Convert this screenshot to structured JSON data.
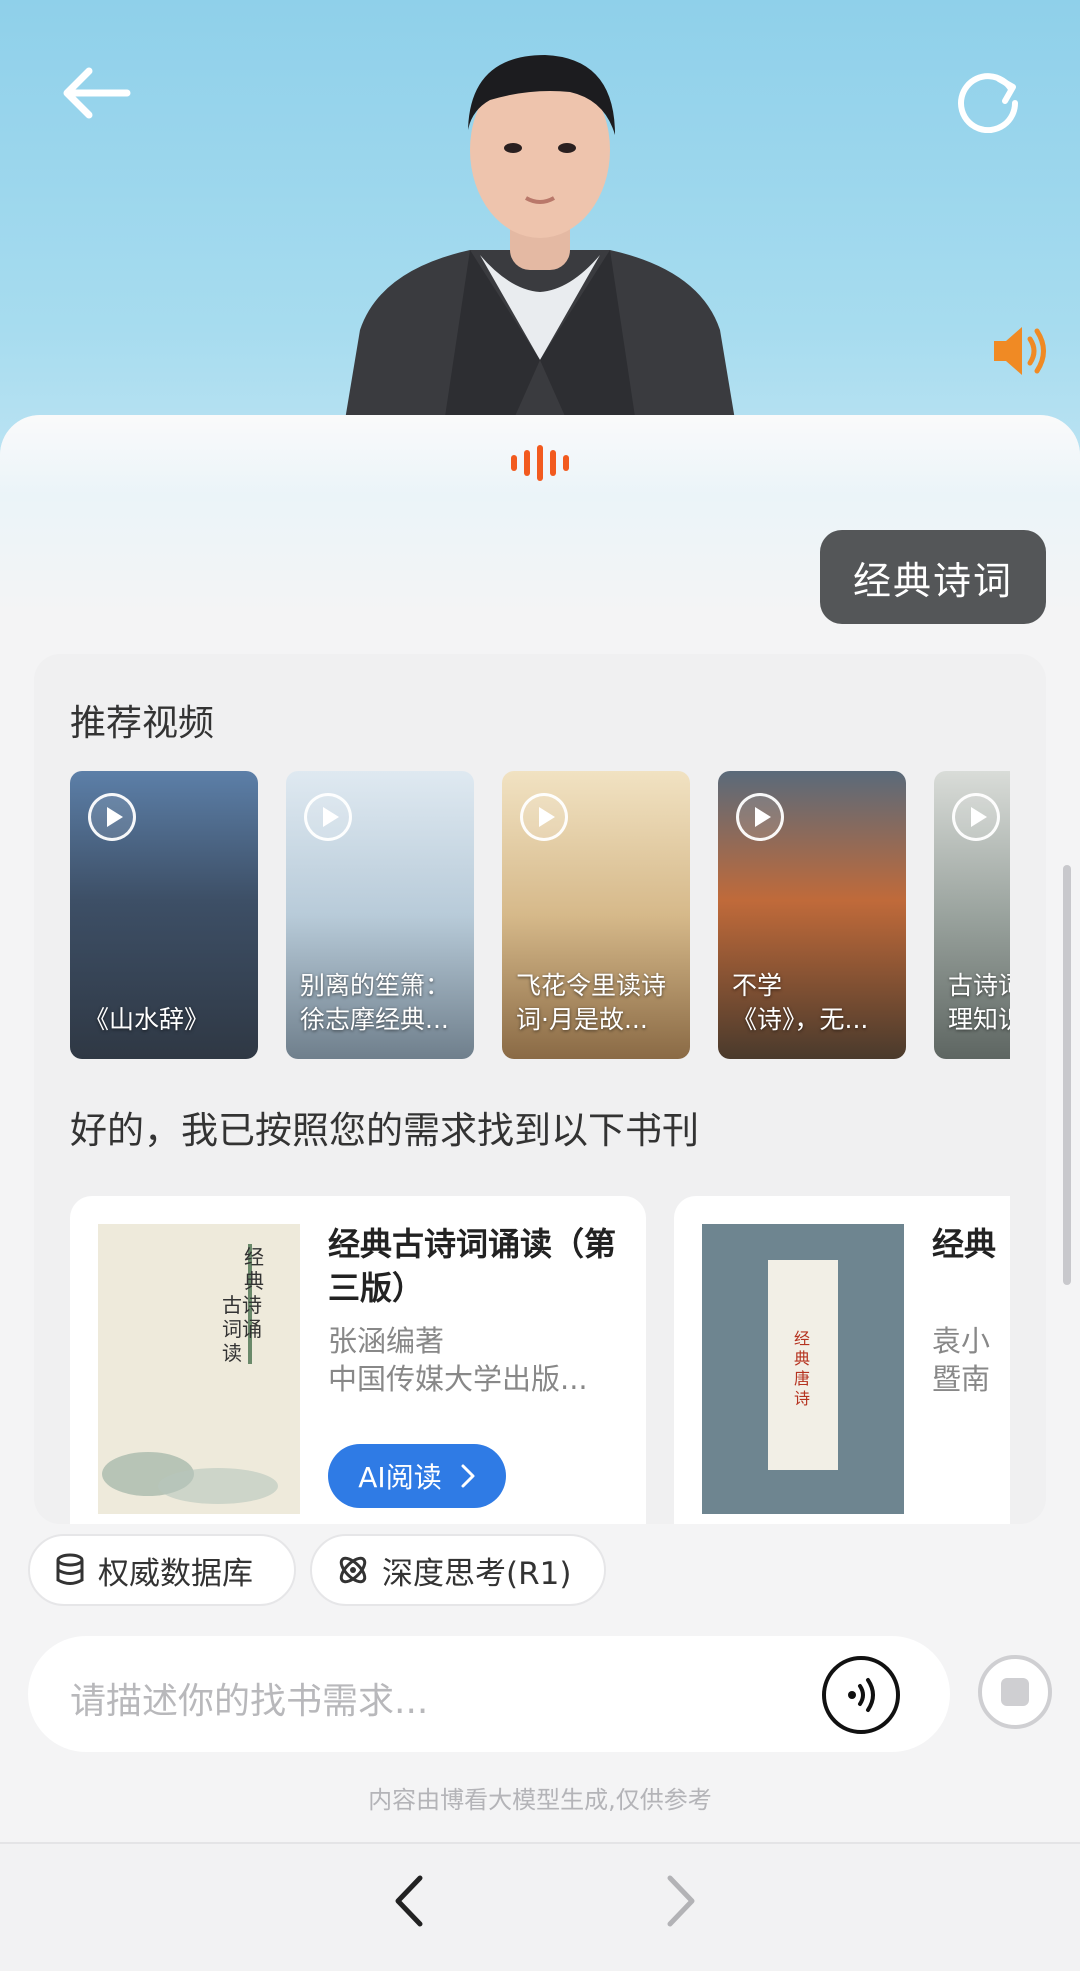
{
  "assistant_bubble": "经典诗词",
  "videos_section": {
    "title": "推荐视频",
    "items": [
      {
        "caption": "《山水辞》",
        "theme": "#3d4f66"
      },
      {
        "caption": "别离的笙箫：\n徐志摩经典...",
        "theme": "#9fb7c8"
      },
      {
        "caption": "飞花令里读诗\n词·月是故...",
        "theme": "#d6b98a"
      },
      {
        "caption": "不学\n《诗》，无...",
        "theme": "#7a5a3c"
      },
      {
        "caption": "古诗词\n理知识",
        "theme": "#8e9a96"
      }
    ]
  },
  "reply_text": "好的，我已按照您的需求找到以下书刊",
  "books": [
    {
      "title": "经典古诗词诵读（第三版）",
      "author": "张涵编著",
      "publisher": "中国传媒大学出版...",
      "action_label": "AI阅读"
    },
    {
      "title": "经典",
      "author": "袁小",
      "publisher": "暨南",
      "action_label": ""
    }
  ],
  "chips": {
    "database": "权威数据库",
    "deep_think": "深度思考(R1)"
  },
  "input": {
    "placeholder": "请描述你的找书需求..."
  },
  "disclaimer": "内容由博看大模型生成,仅供参考",
  "colors": {
    "accent_blue": "#2f7be5",
    "voice_orange": "#f25a1e",
    "bubble_dark": "#545658"
  },
  "icons": [
    "back-arrow-icon",
    "refresh-icon",
    "speaker-icon",
    "voice-wave-icon",
    "play-icon",
    "database-icon",
    "deep-think-icon",
    "voice-input-icon",
    "stop-icon",
    "chevron-left-icon",
    "chevron-right-icon"
  ]
}
